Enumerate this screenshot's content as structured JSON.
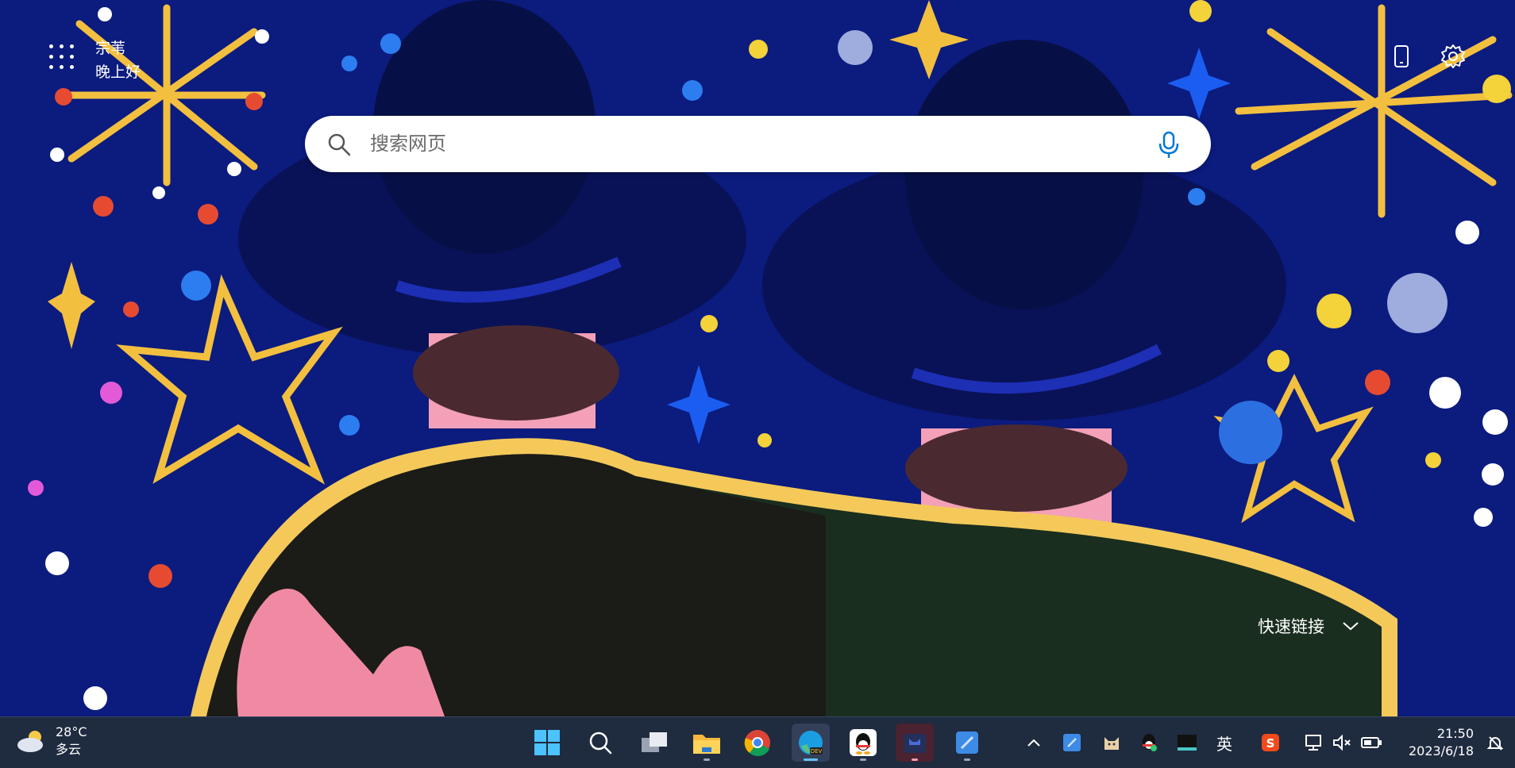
{
  "header": {
    "user_name": "宗苇",
    "greeting": "晚上好"
  },
  "search": {
    "placeholder": "搜索网页"
  },
  "quick_links": {
    "label": "快速链接"
  },
  "icons": {
    "apps": "apps-grid-icon",
    "phone": "phone-icon",
    "settings": "gear-icon",
    "search": "search-icon",
    "mic": "microphone-icon",
    "chevron": "chevron-down-icon"
  },
  "taskbar": {
    "weather": {
      "temperature": "28°C",
      "condition": "多云"
    },
    "apps": [
      "start",
      "search",
      "task-view",
      "file-explorer",
      "chrome",
      "edge-dev",
      "qq",
      "app-cat",
      "remote-desktop"
    ],
    "tray": {
      "ime": "英"
    },
    "clock": {
      "time": "21:50",
      "date": "2023/6/18"
    }
  },
  "colors": {
    "background": "#0a1a78",
    "taskbar": "#1f2b3f",
    "accent": "#0078d4"
  }
}
